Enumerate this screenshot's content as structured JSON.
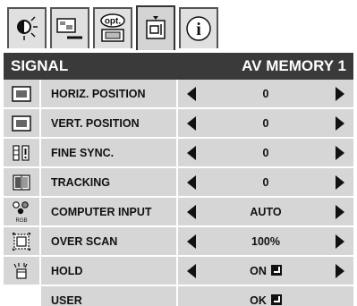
{
  "tabs": [
    {
      "name": "image-adjust-tab",
      "icon": "brightness-icon",
      "label": ""
    },
    {
      "name": "picture-tab",
      "icon": "picture-icon",
      "label": ""
    },
    {
      "name": "option-tab",
      "icon": "option-icon",
      "label": "opt."
    },
    {
      "name": "signal-tab",
      "icon": "signal-icon",
      "label": ""
    },
    {
      "name": "info-tab",
      "icon": "info-icon",
      "label": "i"
    }
  ],
  "header": {
    "title": "SIGNAL",
    "memory": "AV MEMORY 1"
  },
  "rows": [
    {
      "icon": "horiz-position-icon",
      "label": "HORIZ. POSITION",
      "value": "0",
      "arrows": true,
      "enter": false
    },
    {
      "icon": "vert-position-icon",
      "label": "VERT. POSITION",
      "value": "0",
      "arrows": true,
      "enter": false
    },
    {
      "icon": "fine-sync-icon",
      "label": "FINE SYNC.",
      "value": "0",
      "arrows": true,
      "enter": false
    },
    {
      "icon": "tracking-icon",
      "label": "TRACKING",
      "value": "0",
      "arrows": true,
      "enter": false
    },
    {
      "icon": "computer-input-icon",
      "label": "COMPUTER INPUT",
      "value": "AUTO",
      "arrows": true,
      "enter": false,
      "icon_caption": "RGB"
    },
    {
      "icon": "over-scan-icon",
      "label": "OVER SCAN",
      "value": "100%",
      "arrows": true,
      "enter": false
    },
    {
      "icon": "hold-icon",
      "label": "HOLD",
      "value": "ON",
      "arrows": true,
      "enter": true
    },
    {
      "icon": "",
      "label": "USER",
      "value": "OK",
      "arrows": false,
      "enter": true
    }
  ]
}
